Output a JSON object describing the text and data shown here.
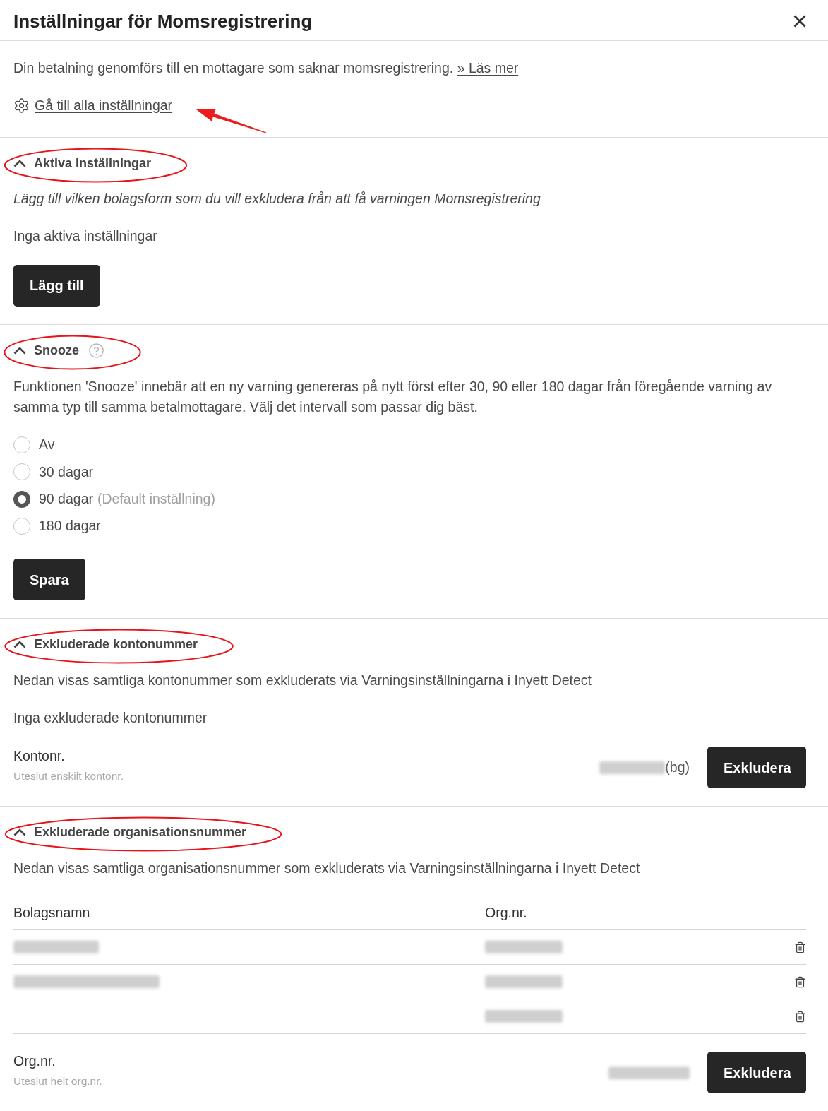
{
  "dialog": {
    "title": "Inställningar för Momsregistrering"
  },
  "intro": {
    "text": "Din betalning genomförs till en mottagare som saknar momsregistrering.",
    "link": "» Läs mer",
    "settings_link": "Gå till alla inställningar",
    "arrow_annotation": true
  },
  "sections": [
    {
      "kind": "active_settings",
      "title": "Aktiva inställningar",
      "expanded": true,
      "circled": true,
      "description": "Lägg till vilken bolagsform som du vill exkludera från att få varningen Momsregistrering",
      "empty_text": "Inga aktiva inställningar",
      "button": "Lägg till"
    },
    {
      "kind": "snooze",
      "title": "Snooze",
      "expanded": true,
      "circled": true,
      "description": "Funktionen 'Snooze' innebär att en ny varning genereras på nytt först efter 30, 90 eller 180 dagar från föregående varning av samma typ till samma betalmottagare. Välj det intervall som passar dig bäst.",
      "options": [
        {
          "label": "Av",
          "selected": false
        },
        {
          "label": "30 dagar",
          "selected": false
        },
        {
          "label": "90 dagar",
          "note": "(Default inställning)",
          "selected": true
        },
        {
          "label": "180 dagar",
          "selected": false
        }
      ],
      "button": "Spara"
    },
    {
      "kind": "excluded_accounts",
      "title": "Exkluderade kontonummer",
      "expanded": true,
      "circled": true,
      "description": "Nedan visas samtliga kontonummer som exkluderats via Varningsinställningarna i Inyett Detect",
      "empty_text": "Inga exkluderade kontonummer",
      "form": {
        "label": "Kontonr.",
        "hint": "Uteslut enskilt kontonr.",
        "value_redacted": true,
        "suffix": "(bg)",
        "button": "Exkludera"
      }
    },
    {
      "kind": "excluded_orgs",
      "title": "Exkluderade organisationsnummer",
      "expanded": true,
      "circled": true,
      "description": "Nedan visas samtliga organisationsnummer som exkluderats via Varningsinställningarna i Inyett Detect",
      "table": {
        "columns": [
          "Bolagsnamn",
          "Org.nr."
        ],
        "rows": [
          {
            "name_redacted": true,
            "org_nr_redacted": true
          },
          {
            "name_redacted": true,
            "org_nr_redacted": true
          },
          {
            "name_redacted": false,
            "org_nr_redacted": true
          }
        ]
      },
      "form": {
        "label": "Org.nr.",
        "hint": "Uteslut helt org.nr.",
        "value_redacted": true,
        "button": "Exkludera"
      }
    }
  ]
}
